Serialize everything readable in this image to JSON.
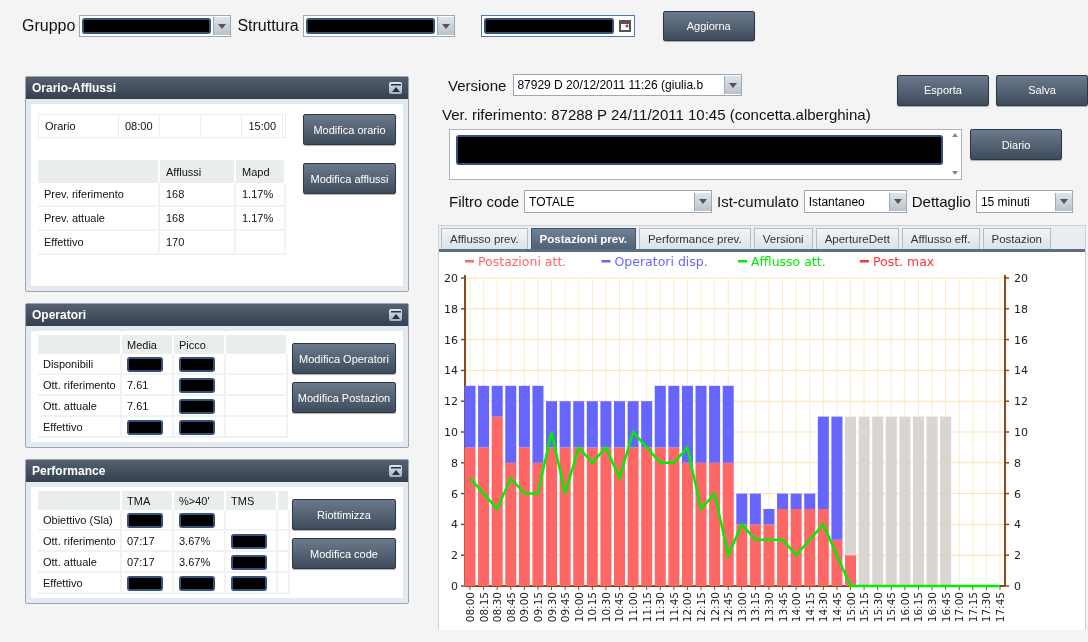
{
  "toolbar": {
    "fields": [
      {
        "label": "Gruppo",
        "kind": "select",
        "redacted": true
      },
      {
        "label": "Struttura",
        "kind": "select",
        "redacted": true
      },
      {
        "kind": "date",
        "redacted": true
      }
    ],
    "button": "Aggiorna"
  },
  "panels": [
    {
      "title": "Orario-Afflussi",
      "kind": "afflussi",
      "schedule": {
        "label": "Orario",
        "start": "08:00",
        "end": "15:00"
      },
      "columns": [
        "Afflussi",
        "Mapd"
      ],
      "rows": [
        {
          "label": "Prev. riferimento",
          "cells": [
            {
              "kind": "text",
              "text": "168"
            },
            {
              "kind": "text",
              "text": "1.17%"
            }
          ]
        },
        {
          "label": "Prev. attuale",
          "cells": [
            {
              "kind": "text",
              "text": "168"
            },
            {
              "kind": "text",
              "text": "1.17%"
            }
          ]
        },
        {
          "label": "Effettivo",
          "cells": [
            {
              "kind": "text",
              "text": "170"
            },
            {
              "kind": "empty"
            }
          ]
        }
      ],
      "buttons": [
        "Modifica orario",
        "Modifica afflussi"
      ]
    },
    {
      "title": "Operatori",
      "kind": "grid",
      "columns": [
        "Media",
        "Picco"
      ],
      "rows": [
        {
          "label": "Disponibili",
          "cells": [
            {
              "kind": "redacted"
            },
            {
              "kind": "redacted"
            }
          ]
        },
        {
          "label": "Ott. riferimento",
          "cells": [
            {
              "kind": "text",
              "text": "7.61"
            },
            {
              "kind": "redacted"
            }
          ]
        },
        {
          "label": "Ott. attuale",
          "cells": [
            {
              "kind": "text",
              "text": "7.61"
            },
            {
              "kind": "redacted"
            }
          ]
        },
        {
          "label": "Effettivo",
          "cells": [
            {
              "kind": "redacted"
            },
            {
              "kind": "redacted"
            }
          ]
        }
      ],
      "buttons": [
        "Modifica Operatori",
        "Modifica Postazion"
      ]
    },
    {
      "title": "Performance",
      "kind": "grid",
      "columns": [
        "TMA",
        "%>40'",
        "TMS"
      ],
      "rows": [
        {
          "label": "Obiettivo (Sla)",
          "cells": [
            {
              "kind": "redacted"
            },
            {
              "kind": "redacted"
            },
            {
              "kind": "empty"
            }
          ]
        },
        {
          "label": "Ott. riferimento",
          "cells": [
            {
              "kind": "text",
              "text": "07:17"
            },
            {
              "kind": "text",
              "text": "3.67%"
            },
            {
              "kind": "redacted"
            }
          ]
        },
        {
          "label": "Ott. attuale",
          "cells": [
            {
              "kind": "text",
              "text": "07:17"
            },
            {
              "kind": "text",
              "text": "3.67%"
            },
            {
              "kind": "redacted"
            }
          ]
        },
        {
          "label": "Effettivo",
          "cells": [
            {
              "kind": "redacted"
            },
            {
              "kind": "redacted"
            },
            {
              "kind": "redacted"
            }
          ]
        }
      ],
      "buttons": [
        "Riottimizza",
        "Modifica code"
      ]
    }
  ],
  "version": {
    "label": "Versione",
    "value": "87929 D 20/12/2011 11:26 (giulia.b",
    "buttons": [
      "Esporta",
      "Salva"
    ]
  },
  "reference": "Ver. riferimento: 87288 P 24/11/2011 10:45 (concetta.alberghina)",
  "notes": {
    "redacted": true,
    "button": "Diario"
  },
  "filters": [
    {
      "label": "Filtro code",
      "value": "TOTALE"
    },
    {
      "label": "Ist-cumulato",
      "value": "Istantaneo"
    },
    {
      "label": "Dettaglio",
      "value": "15 minuti"
    }
  ],
  "tabs": [
    {
      "label": "Afflusso prev.",
      "selected": false
    },
    {
      "label": "Postazioni prev.",
      "selected": true
    },
    {
      "label": "Performance prev.",
      "selected": false
    },
    {
      "label": "Versioni",
      "selected": false
    },
    {
      "label": "ApertureDett",
      "selected": false
    },
    {
      "label": "Afflusso eff.",
      "selected": false
    },
    {
      "label": "Postazion",
      "selected": false
    }
  ],
  "chart_data": {
    "type": "bar",
    "stacked": true,
    "grid": true,
    "legend": true,
    "ylim": [
      0,
      20
    ],
    "y2lim": [
      0,
      20
    ],
    "yticks": [
      0,
      2,
      4,
      6,
      8,
      10,
      12,
      14,
      16,
      18,
      20
    ],
    "y2ticks": [
      0,
      2,
      4,
      6,
      8,
      10,
      12,
      14,
      16,
      18,
      20
    ],
    "categories": [
      "08:00",
      "08:15",
      "08:30",
      "08:45",
      "09:00",
      "09:15",
      "09:30",
      "09:45",
      "10:00",
      "10:15",
      "10:30",
      "10:45",
      "11:00",
      "11:15",
      "11:30",
      "11:45",
      "12:00",
      "12:15",
      "12:30",
      "12:45",
      "13:00",
      "13:15",
      "13:30",
      "13:45",
      "14:00",
      "14:15",
      "14:30",
      "14:45",
      "15:00",
      "15:15",
      "15:30",
      "15:45",
      "16:00",
      "16:15",
      "16:30",
      "16:45",
      "17:00",
      "17:15",
      "17:30",
      "17:45"
    ],
    "series": [
      {
        "name": "Postazioni att.",
        "color": "#ff6666",
        "values": [
          9,
          9,
          11,
          8,
          9,
          8,
          9,
          9,
          9,
          9,
          9,
          9,
          9,
          9,
          9,
          9,
          8,
          8,
          8,
          8,
          4,
          4,
          4,
          5,
          5,
          5,
          5,
          3,
          2,
          null,
          null,
          null,
          null,
          null,
          null,
          null,
          null,
          null,
          null,
          null
        ]
      },
      {
        "name": "Operatori disp.",
        "color": "#6666ff",
        "values": [
          4,
          4,
          2,
          5,
          4,
          5,
          3,
          3,
          3,
          3,
          3,
          3,
          3,
          3,
          4,
          4,
          5,
          5,
          5,
          5,
          2,
          2,
          1,
          1,
          1,
          1,
          6,
          8,
          null,
          null,
          null,
          null,
          null,
          null,
          null,
          null,
          null,
          null,
          null,
          null
        ]
      },
      {
        "color": "#d9d6d2",
        "values": [
          null,
          null,
          null,
          null,
          null,
          null,
          null,
          null,
          null,
          null,
          null,
          null,
          null,
          null,
          null,
          null,
          null,
          null,
          null,
          null,
          null,
          null,
          null,
          null,
          null,
          null,
          null,
          null,
          9,
          11,
          11,
          11,
          11,
          11,
          11,
          11,
          null,
          null,
          null,
          null
        ]
      },
      {
        "name": "Afflusso att.",
        "type": "line",
        "color": "#00ee00",
        "values": [
          7,
          6,
          5,
          7,
          6,
          6,
          10,
          6,
          9,
          8,
          9,
          7,
          10,
          9,
          8,
          8,
          9,
          5,
          6,
          2,
          4,
          3,
          3,
          3,
          2,
          3,
          4,
          2,
          0,
          0,
          0,
          0,
          0,
          0,
          0,
          0,
          0,
          0,
          0,
          0
        ]
      },
      {
        "name": "Post. max",
        "type": "line",
        "color": "#ff3333",
        "values": [
          null,
          null,
          null,
          null,
          null,
          null,
          null,
          null,
          null,
          null,
          null,
          null,
          null,
          null,
          null,
          null,
          null,
          null,
          null,
          null,
          null,
          null,
          null,
          null,
          null,
          null,
          null,
          null,
          null,
          null,
          null,
          null,
          null,
          null,
          null,
          null,
          null,
          null,
          null,
          null
        ]
      }
    ]
  }
}
